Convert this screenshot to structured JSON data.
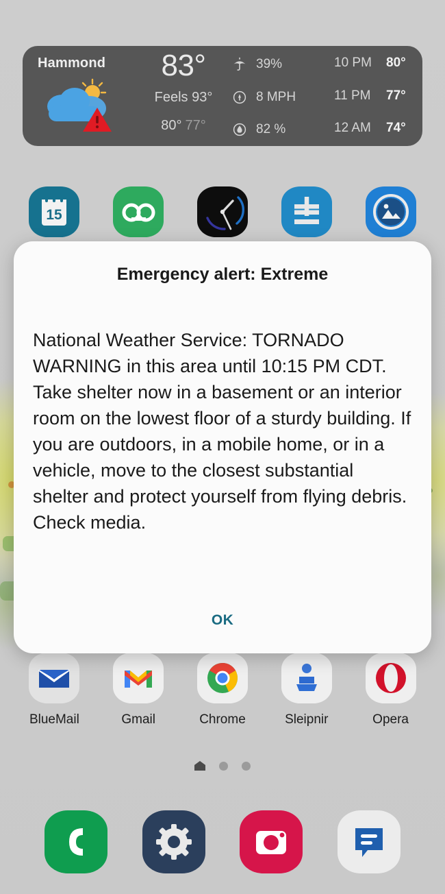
{
  "weather": {
    "city": "Hammond",
    "current_temp": "83°",
    "feels_like": "Feels 93°",
    "high": "80°",
    "low": "77°",
    "condition_icon": "partly-cloudy-icon",
    "alert_icon": "warning-triangle-icon",
    "conditions": [
      {
        "icon": "umbrella-icon",
        "value": "39%"
      },
      {
        "icon": "wind-icon",
        "value": "8 MPH"
      },
      {
        "icon": "humidity-icon",
        "value": "82 %"
      }
    ],
    "hourly": [
      {
        "time": "10 PM",
        "temp": "80°"
      },
      {
        "time": "11 PM",
        "temp": "77°"
      },
      {
        "time": "12 AM",
        "temp": "74°"
      }
    ]
  },
  "app_row_top": [
    {
      "label": "",
      "icon": "calendar-icon",
      "day": "15"
    },
    {
      "label": "",
      "icon": "voicemail-icon"
    },
    {
      "label": "",
      "icon": "clock-icon"
    },
    {
      "label": "",
      "icon": "calculator-icon"
    },
    {
      "label": "",
      "icon": "gallery-icon"
    }
  ],
  "app_row_bottom": [
    {
      "label": "BlueMail",
      "icon": "bluemail-icon"
    },
    {
      "label": "Gmail",
      "icon": "gmail-icon"
    },
    {
      "label": "Chrome",
      "icon": "chrome-icon"
    },
    {
      "label": "Sleipnir",
      "icon": "sleipnir-icon"
    },
    {
      "label": "Opera",
      "icon": "opera-icon"
    }
  ],
  "page_indicator": {
    "pages": 3,
    "active_index": 0
  },
  "dock": [
    {
      "icon": "phone-icon"
    },
    {
      "icon": "settings-gear-icon"
    },
    {
      "icon": "camera-icon"
    },
    {
      "icon": "messages-icon"
    }
  ],
  "dialog": {
    "title": "Emergency alert: Extreme",
    "message": "National Weather Service: TORNADO WARNING in this area until 10:15 PM CDT. Take shelter now in a basement or an interior room on the lowest floor of a sturdy building. If you are outdoors, in a mobile home, or in a vehicle, move to the closest substantial shelter and protect yourself from flying debris. Check media.",
    "ok_label": "OK"
  },
  "colors": {
    "wallpaper": "#cccccc",
    "widget_bg": "#565656",
    "dialog_bg": "#fbfbfb",
    "ok_accent": "#1a6b82",
    "alert_red": "#e01b24"
  }
}
